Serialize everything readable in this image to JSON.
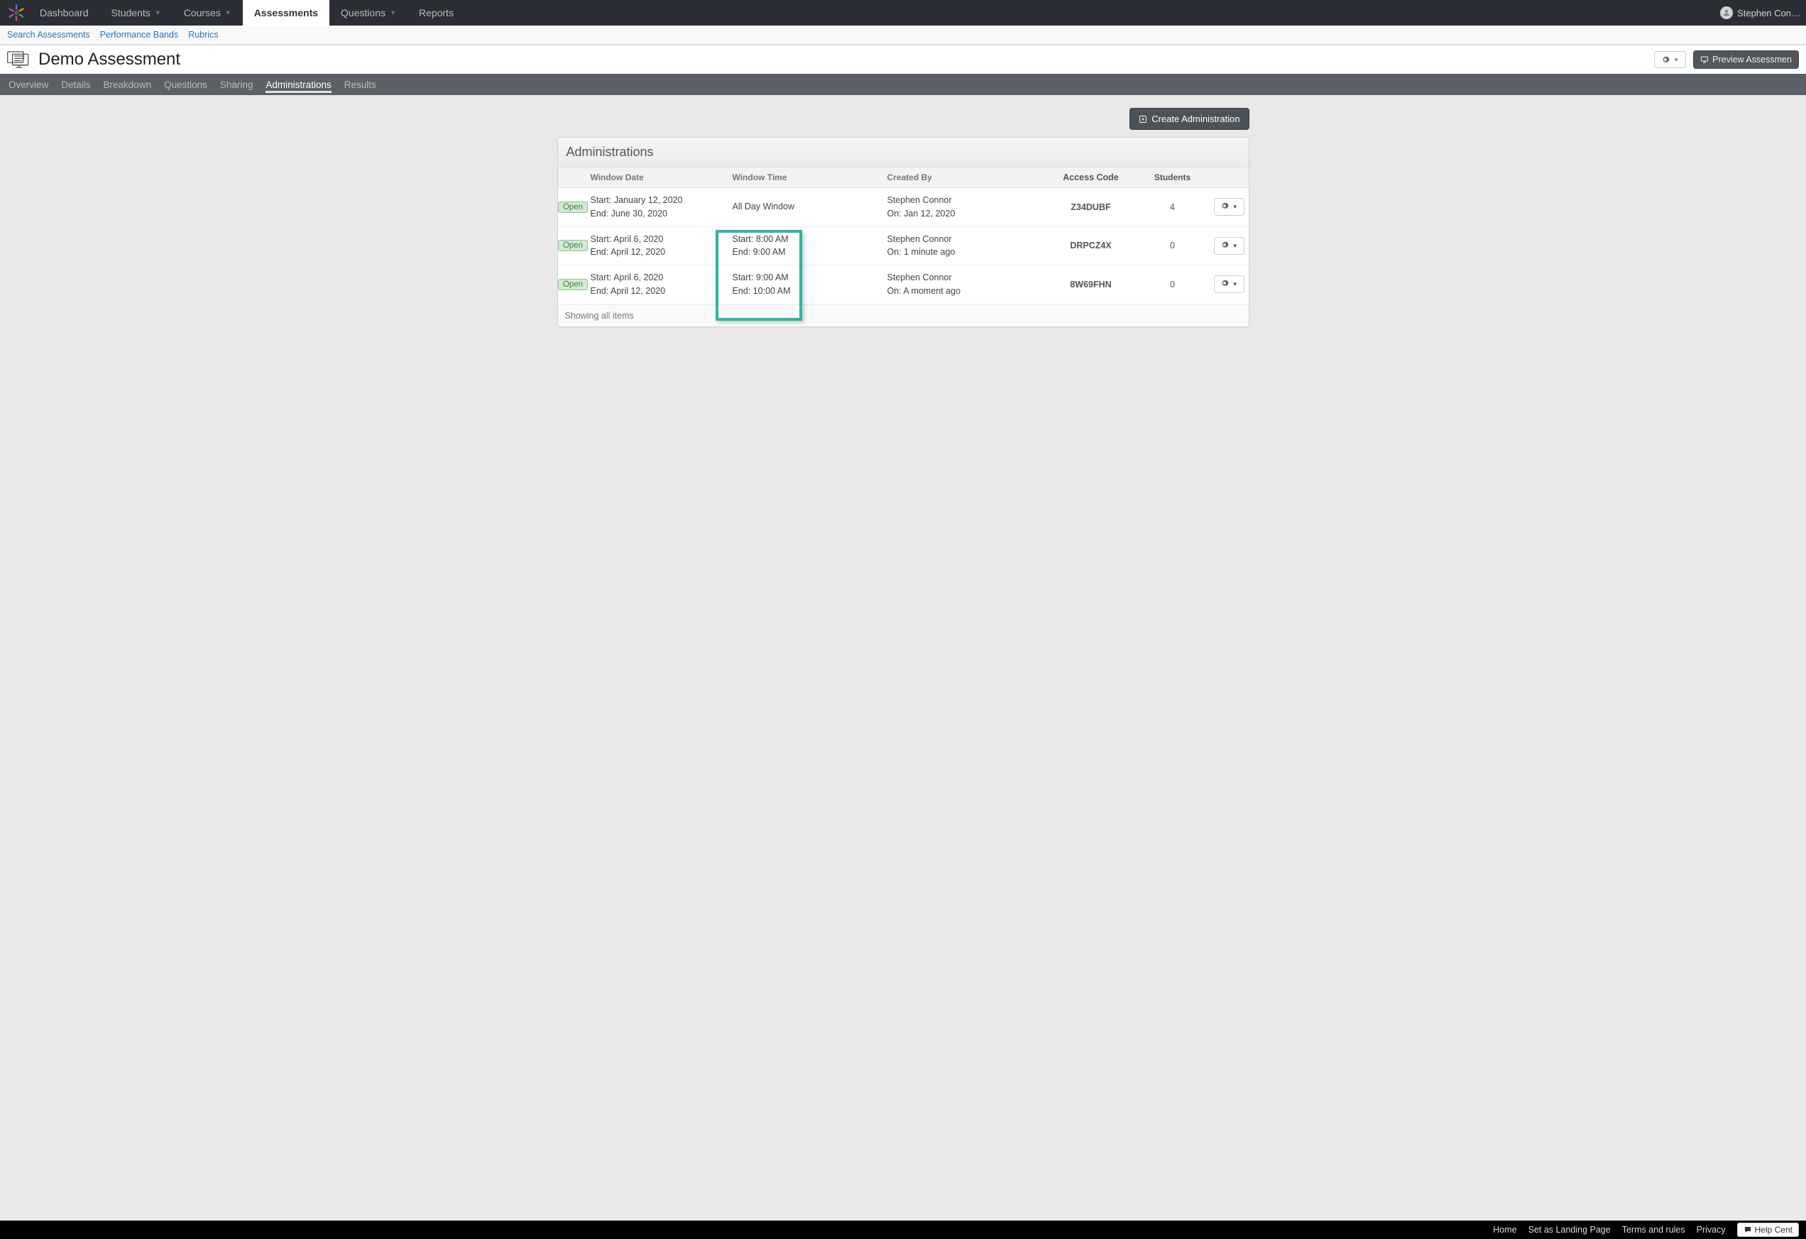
{
  "nav": {
    "items": [
      {
        "label": "Dashboard",
        "has_menu": false
      },
      {
        "label": "Students",
        "has_menu": true
      },
      {
        "label": "Courses",
        "has_menu": true
      },
      {
        "label": "Assessments",
        "has_menu": false
      },
      {
        "label": "Questions",
        "has_menu": true
      },
      {
        "label": "Reports",
        "has_menu": false
      }
    ],
    "active": "Assessments",
    "user": "Stephen Con…"
  },
  "subnav": {
    "items": [
      "Search Assessments",
      "Performance Bands",
      "Rubrics"
    ]
  },
  "page": {
    "title": "Demo Assessment",
    "settings_button": "",
    "preview_button": "Preview Assessmen"
  },
  "tabs": {
    "items": [
      "Overview",
      "Details",
      "Breakdown",
      "Questions",
      "Sharing",
      "Administrations",
      "Results"
    ],
    "active": "Administrations"
  },
  "toolbar": {
    "create_button": "Create Administration"
  },
  "panel": {
    "title": "Administrations",
    "columns": {
      "status": "",
      "window_date": "Window Date",
      "window_time": "Window Time",
      "created_by": "Created By",
      "access_code": "Access Code",
      "students": "Students"
    },
    "rows": [
      {
        "status": "Open",
        "date_start": "Start: January 12, 2020",
        "date_end": "End: June 30, 2020",
        "time_start": "All Day Window",
        "time_end": "",
        "creator": "Stephen Connor",
        "created_on": "On: Jan 12, 2020",
        "access_code": "Z34DUBF",
        "students": "4"
      },
      {
        "status": "Open",
        "date_start": "Start: April 6, 2020",
        "date_end": "End: April 12, 2020",
        "time_start": "Start: 8:00 AM",
        "time_end": "End: 9:00 AM",
        "creator": "Stephen Connor",
        "created_on": "On: 1 minute ago",
        "access_code": "DRPCZ4X",
        "students": "0"
      },
      {
        "status": "Open",
        "date_start": "Start: April 6, 2020",
        "date_end": "End: April 12, 2020",
        "time_start": "Start: 9:00 AM",
        "time_end": "End: 10:00 AM",
        "creator": "Stephen Connor",
        "created_on": "On: A moment ago",
        "access_code": "8W69FHN",
        "students": "0"
      }
    ],
    "footer": "Showing all items"
  },
  "footer": {
    "links": [
      "Home",
      "Set as Landing Page",
      "Terms and rules",
      "Privacy"
    ],
    "help": "Help Cent"
  }
}
